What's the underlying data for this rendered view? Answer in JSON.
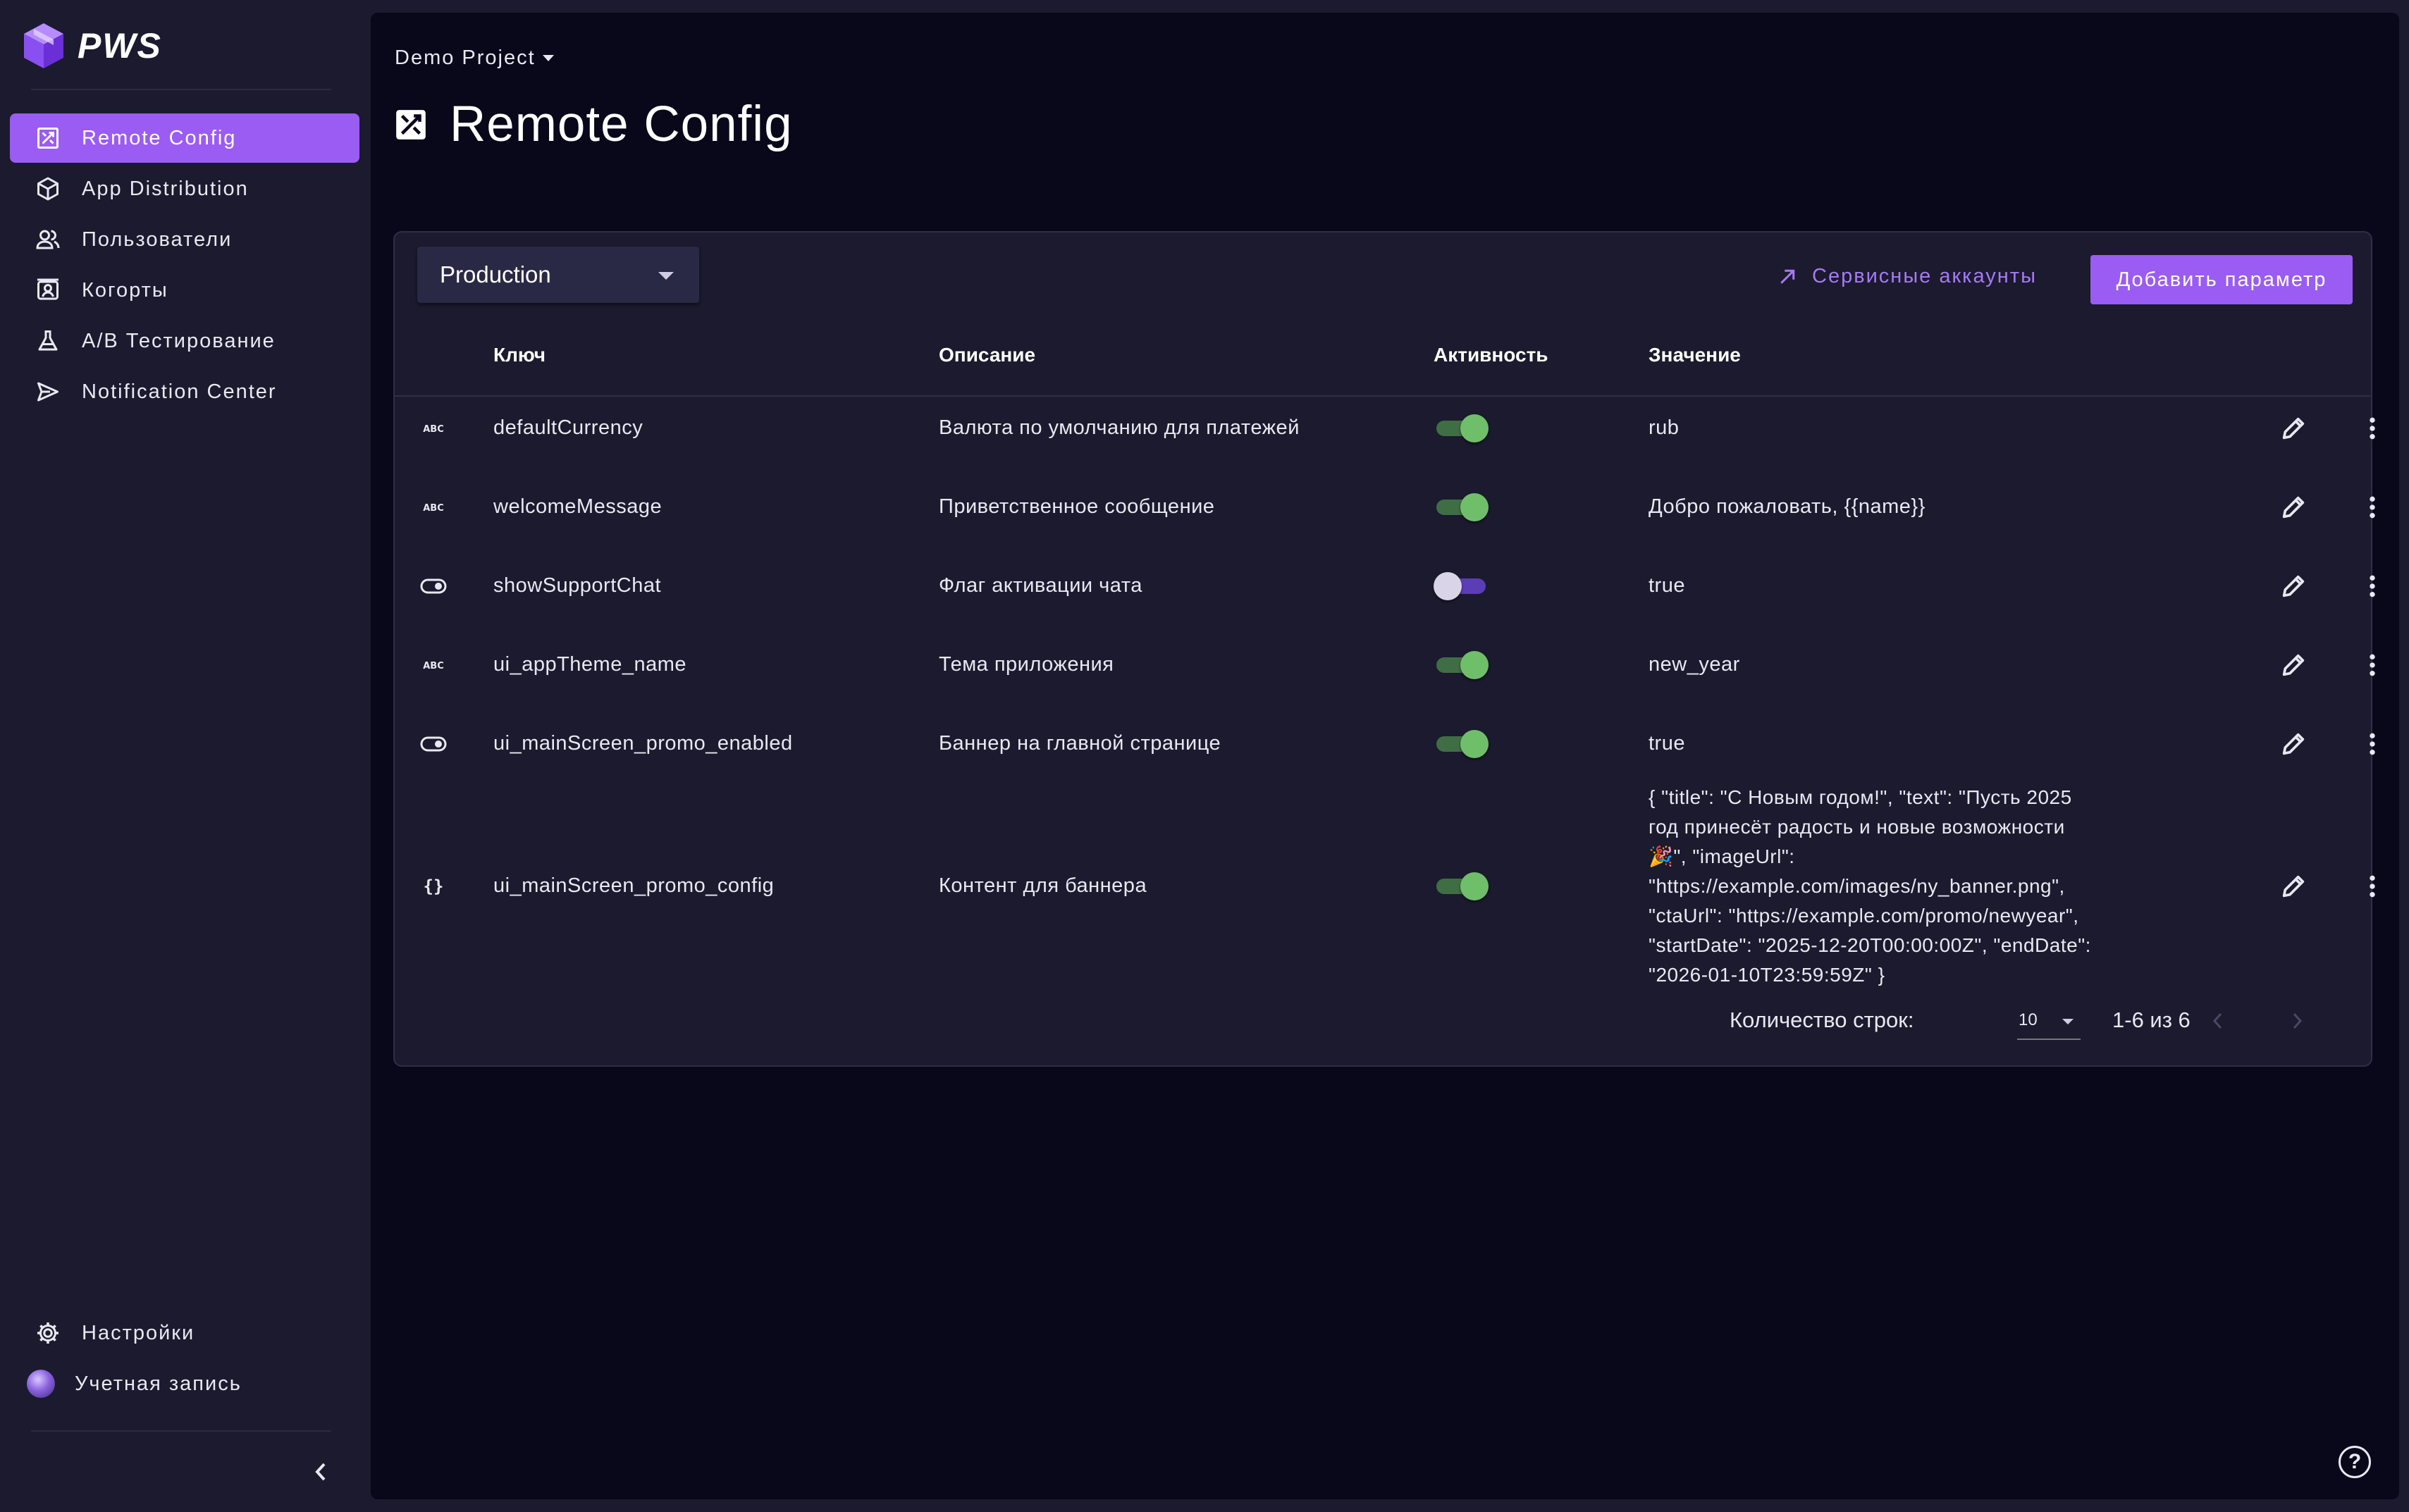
{
  "brand": {
    "name": "PWS",
    "accent": "#9a5cf2"
  },
  "sidebar": {
    "items": [
      {
        "label": "Remote Config",
        "icon": "remote-config-icon",
        "active": true
      },
      {
        "label": "App Distribution",
        "icon": "cube-icon"
      },
      {
        "label": "Пользователи",
        "icon": "users-icon"
      },
      {
        "label": "Когорты",
        "icon": "cohort-icon"
      },
      {
        "label": "A/B Тестирование",
        "icon": "flask-icon"
      },
      {
        "label": "Notification Center",
        "icon": "send-icon"
      }
    ],
    "bottom": [
      {
        "label": "Настройки",
        "icon": "gear-icon"
      },
      {
        "label": "Учетная запись",
        "icon": "avatar"
      }
    ]
  },
  "header": {
    "project": "Demo Project",
    "title": "Remote Config"
  },
  "toolbar": {
    "environment": "Production",
    "service_accounts": "Сервисные аккаунты",
    "add_param": "Добавить параметр"
  },
  "table": {
    "columns": [
      "Ключ",
      "Описание",
      "Активность",
      "Значение"
    ],
    "rows": [
      {
        "type": "string",
        "key": "defaultCurrency",
        "description": "Валюта по умолчанию для платежей",
        "active": true,
        "value": "rub"
      },
      {
        "type": "string",
        "key": "welcomeMessage",
        "description": "Приветственное сообщение",
        "active": true,
        "value": "Добро пожаловать, {{name}}"
      },
      {
        "type": "boolean",
        "key": "showSupportChat",
        "description": "Флаг активации чата",
        "active": false,
        "value": "true"
      },
      {
        "type": "string",
        "key": "ui_appTheme_name",
        "description": "Тема приложения",
        "active": true,
        "value": "new_year"
      },
      {
        "type": "boolean",
        "key": "ui_mainScreen_promo_enabled",
        "description": "Баннер на главной странице",
        "active": true,
        "value": "true"
      },
      {
        "type": "json",
        "key": "ui_mainScreen_promo_config",
        "description": "Контент для баннера",
        "active": true,
        "value_lines": [
          "{ \"title\": \"С Новым годом!\", \"text\": \"Пусть 2025",
          "год принесёт радость и новые возможности",
          "🎉\", \"imageUrl\":",
          "\"https://example.com/images/ny_banner.png\",",
          "\"ctaUrl\": \"https://example.com/promo/newyear\",",
          "\"startDate\": \"2025-12-20T00:00:00Z\", \"endDate\":",
          "\"2026-01-10T23:59:59Z\" }"
        ]
      }
    ]
  },
  "pagination": {
    "rows_label": "Количество строк:",
    "rows_per_page": "10",
    "range": "1-6 из 6"
  },
  "colors": {
    "toggle_on": "#6fbf6a",
    "toggle_off_track": "#5b3db5",
    "surface": "#1b1a2e",
    "content_bg": "#09071a"
  }
}
